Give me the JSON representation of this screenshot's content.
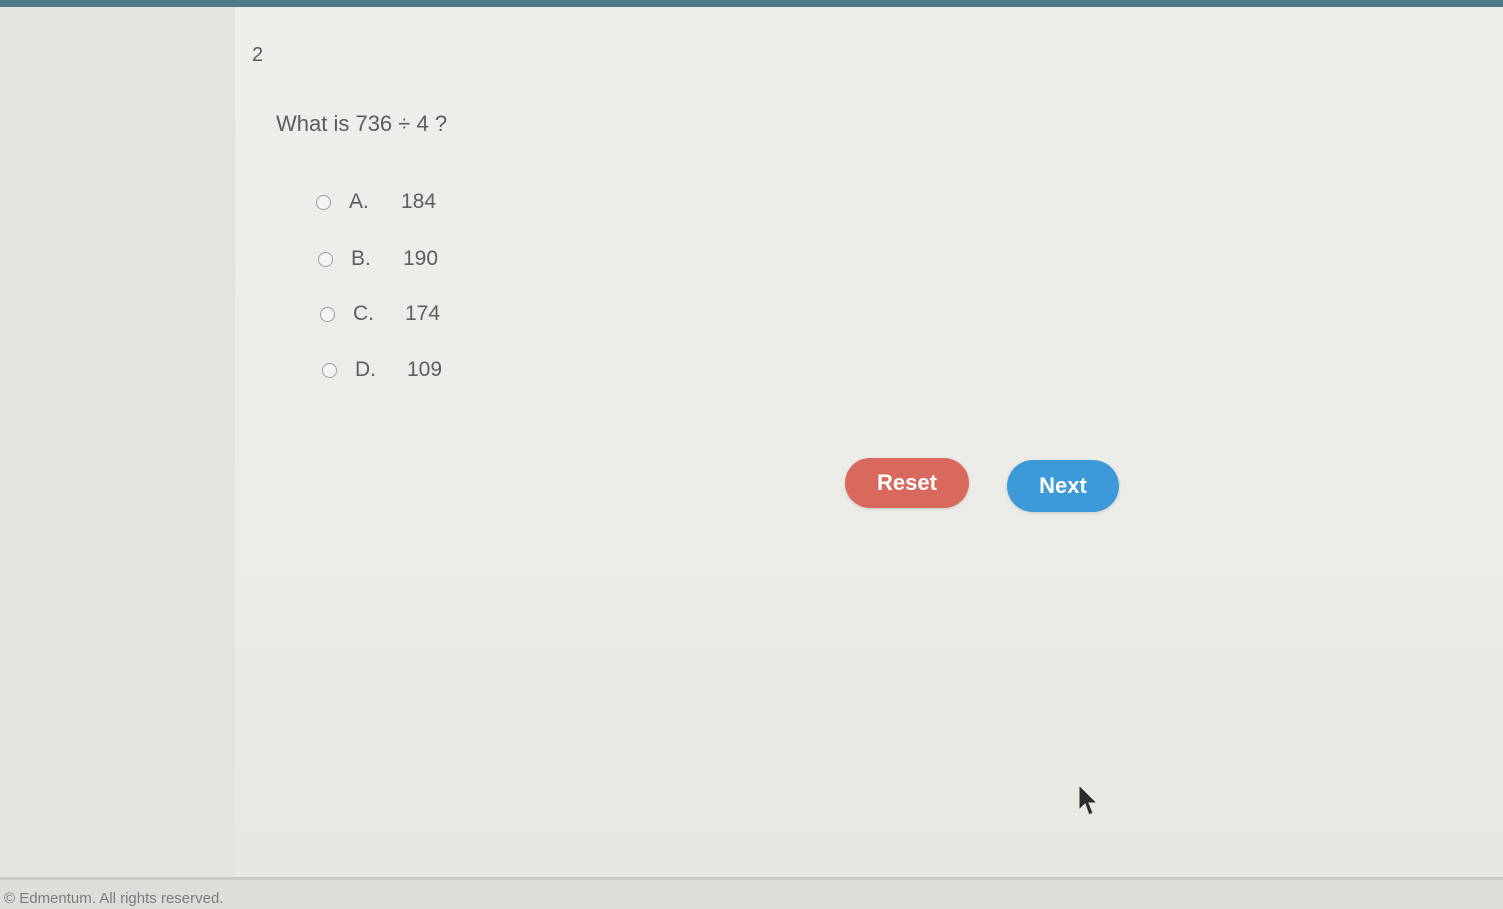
{
  "question": {
    "number": "2",
    "prompt": "What is 736 ÷ 4 ?"
  },
  "choices": [
    {
      "letter": "A.",
      "value": "184"
    },
    {
      "letter": "B.",
      "value": "190"
    },
    {
      "letter": "C.",
      "value": "174"
    },
    {
      "letter": "D.",
      "value": "109"
    }
  ],
  "buttons": {
    "reset_label": "Reset",
    "next_label": "Next"
  },
  "footer": {
    "copyright": "© Edmentum. All rights reserved."
  },
  "colors": {
    "top_bar": "#4f7a86",
    "reset": "#d9695c",
    "next": "#3d9ad9"
  },
  "icons": {
    "pointer": "mouse-pointer-icon"
  }
}
